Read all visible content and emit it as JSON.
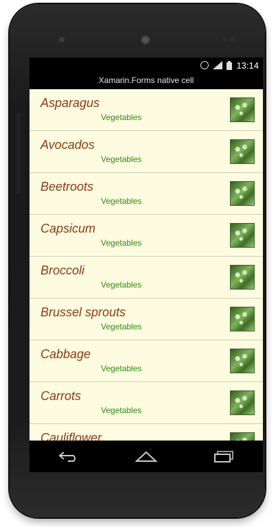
{
  "status_bar": {
    "time": "13:14",
    "icons": [
      "alarm-icon",
      "signal-icon",
      "battery-icon"
    ]
  },
  "app": {
    "title": "Xamarin.Forms native cell"
  },
  "list": {
    "items": [
      {
        "name": "Asparagus",
        "category": "Vegetables"
      },
      {
        "name": "Avocados",
        "category": "Vegetables"
      },
      {
        "name": "Beetroots",
        "category": "Vegetables"
      },
      {
        "name": "Capsicum",
        "category": "Vegetables"
      },
      {
        "name": "Broccoli",
        "category": "Vegetables"
      },
      {
        "name": "Brussel sprouts",
        "category": "Vegetables"
      },
      {
        "name": "Cabbage",
        "category": "Vegetables"
      },
      {
        "name": "Carrots",
        "category": "Vegetables"
      },
      {
        "name": "Cauliflower",
        "category": ""
      }
    ]
  },
  "nav_bar": {
    "buttons": [
      "back-icon",
      "home-icon",
      "recent-apps-icon"
    ]
  },
  "colors": {
    "list_background": "#fdfbe0",
    "item_name": "#8b3a16",
    "item_category": "#2f8a12"
  }
}
